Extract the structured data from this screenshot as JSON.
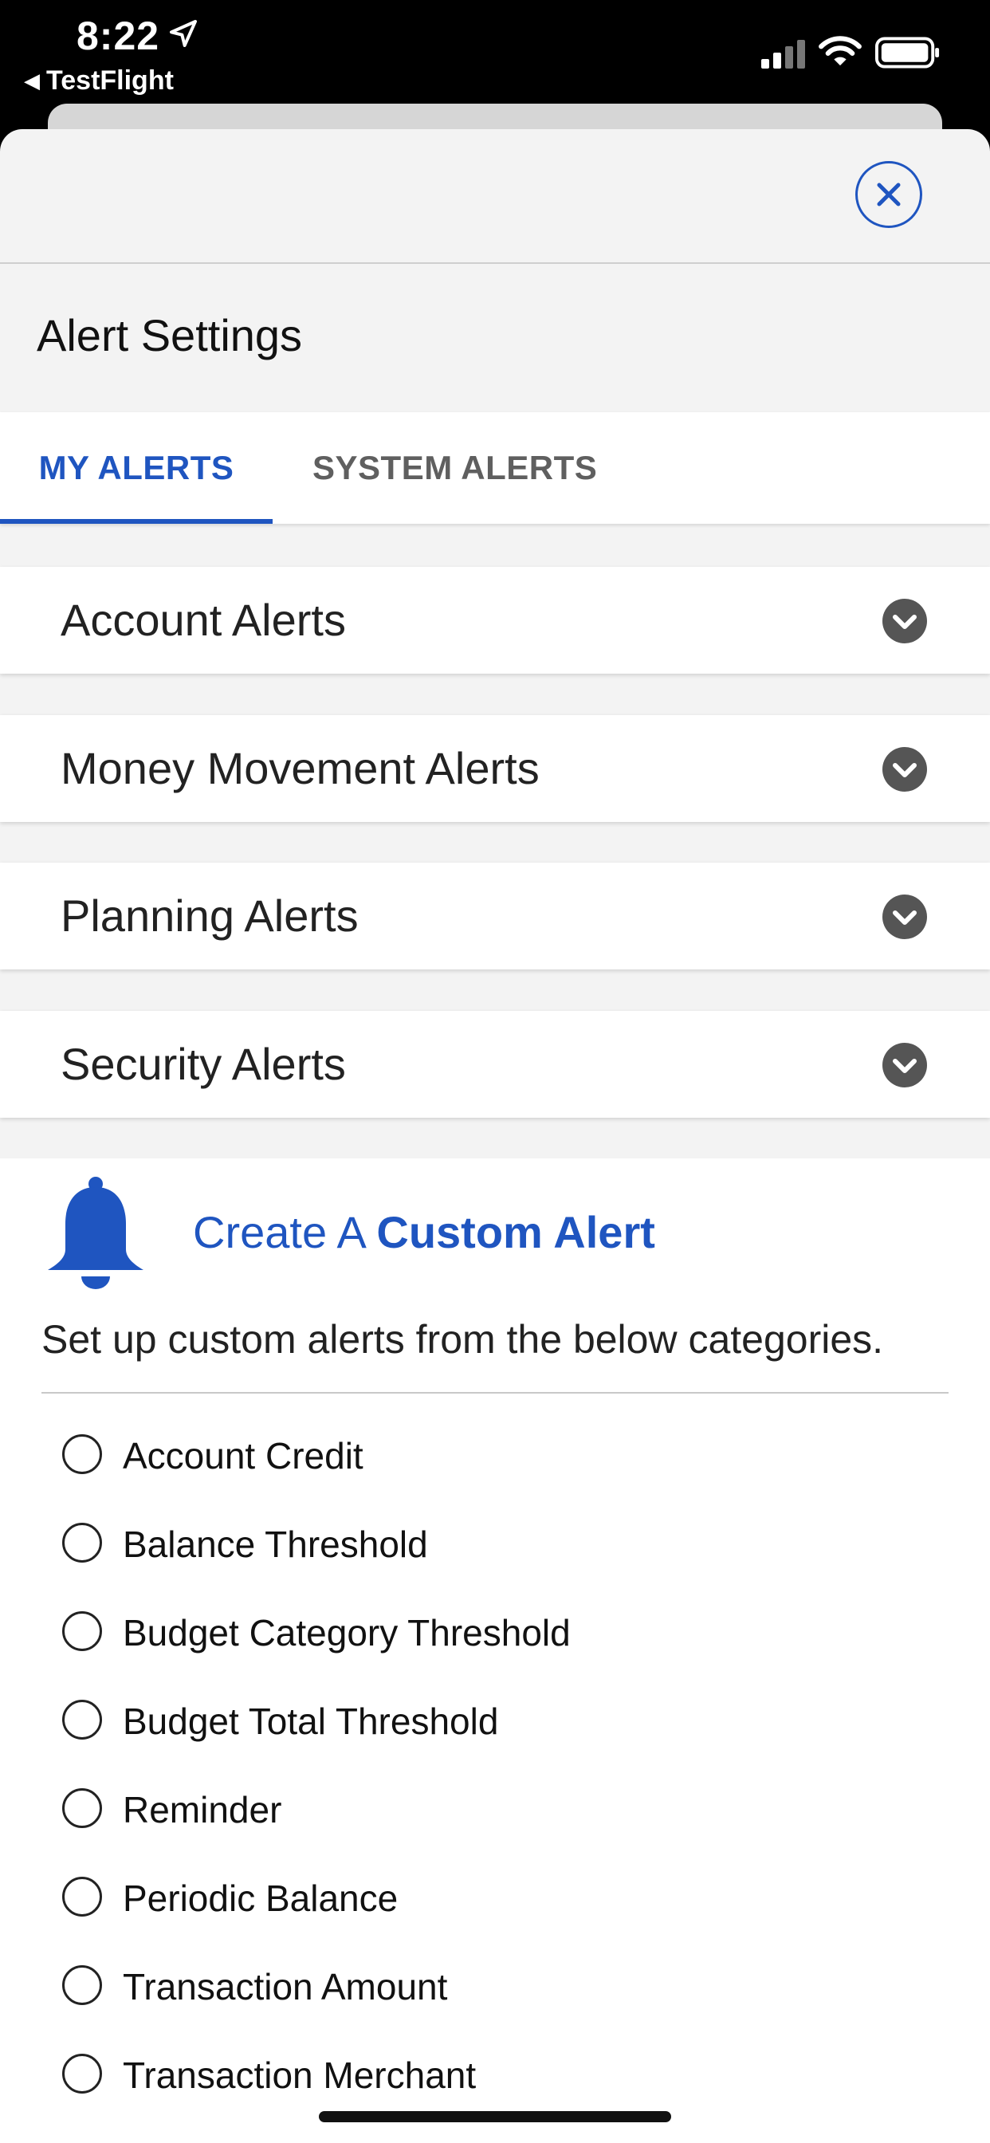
{
  "status_bar": {
    "time": "8:22",
    "back_app": "TestFlight",
    "icons": [
      "location-arrow-icon",
      "cellular-signal-icon",
      "wifi-icon",
      "battery-icon"
    ]
  },
  "sheet": {
    "close_icon": "close-icon",
    "title": "Alert Settings"
  },
  "tabs": [
    {
      "label": "MY ALERTS",
      "active": true
    },
    {
      "label": "SYSTEM ALERTS",
      "active": false
    }
  ],
  "accordions": [
    {
      "label": "Account Alerts",
      "icon": "chevron-down-icon"
    },
    {
      "label": "Money Movement Alerts",
      "icon": "chevron-down-icon"
    },
    {
      "label": "Planning Alerts",
      "icon": "chevron-down-icon"
    },
    {
      "label": "Security Alerts",
      "icon": "chevron-down-icon"
    }
  ],
  "custom_alert": {
    "icon": "bell-icon",
    "title_prefix": "Create A",
    "title_bold": "Custom Alert",
    "description": "Set up custom alerts from the below categories.",
    "options": [
      {
        "label": "Account Credit",
        "checked": false
      },
      {
        "label": "Balance Threshold",
        "checked": false
      },
      {
        "label": "Budget Category Threshold",
        "checked": false
      },
      {
        "label": "Budget Total Threshold",
        "checked": false
      },
      {
        "label": "Reminder",
        "checked": false
      },
      {
        "label": "Periodic Balance",
        "checked": false
      },
      {
        "label": "Transaction Amount",
        "checked": false
      },
      {
        "label": "Transaction Merchant",
        "checked": false
      }
    ]
  },
  "colors": {
    "accent": "#1f55c0",
    "sheet_bg": "#f3f3f3",
    "chevron": "#555555",
    "inactive_tab": "#5f5f5f"
  }
}
